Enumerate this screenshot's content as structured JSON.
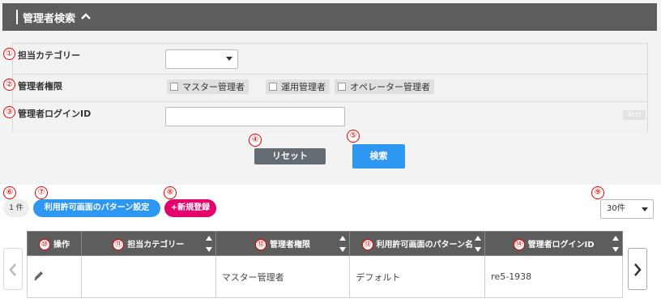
{
  "header": {
    "title": "管理者検索",
    "toggle_icon": "chevron-up-icon"
  },
  "form": {
    "rows": [
      {
        "num": "①",
        "label": "担当カテゴリー"
      },
      {
        "num": "②",
        "label": "管理者権限"
      },
      {
        "num": "③",
        "label": "管理者ログインID"
      }
    ],
    "category_select": {
      "value": ""
    },
    "roles": [
      {
        "label": "マスター管理者",
        "checked": false
      },
      {
        "label": "運用管理者",
        "checked": false
      },
      {
        "label": "オペレーター管理者",
        "checked": false
      }
    ],
    "login_id": {
      "value": "",
      "placeholder": ""
    },
    "test_badge": "Test"
  },
  "actions": {
    "reset": {
      "num": "④",
      "label": "リセット"
    },
    "search": {
      "num": "⑤",
      "label": "検索"
    }
  },
  "toolbar": {
    "count": {
      "num": "⑥",
      "label": "1 件"
    },
    "pattern_button": {
      "num": "⑦",
      "label": "利用許可画面のパターン設定"
    },
    "new_button": {
      "num": "⑧",
      "label": "+新規登録"
    },
    "per_page": {
      "num": "⑨",
      "value": "30件"
    }
  },
  "table": {
    "columns": [
      {
        "num": "⑩",
        "label": "操作",
        "sortable": false
      },
      {
        "num": "⑪",
        "label": "担当カテゴリー",
        "sortable": true
      },
      {
        "num": "⑫",
        "label": "管理者権限",
        "sortable": true
      },
      {
        "num": "⑬",
        "label": "利用許可画面のパターン名",
        "sortable": true
      },
      {
        "num": "⑭",
        "label": "管理者ログインID",
        "sortable": true
      }
    ],
    "rows": [
      {
        "action_icon": "pencil-icon",
        "category": "",
        "role": "マスター管理者",
        "pattern": "デフォルト",
        "login_id": "re5-1938"
      }
    ]
  },
  "pager": {
    "prev_icon": "chevron-left-icon",
    "next_icon": "chevron-right-icon"
  }
}
